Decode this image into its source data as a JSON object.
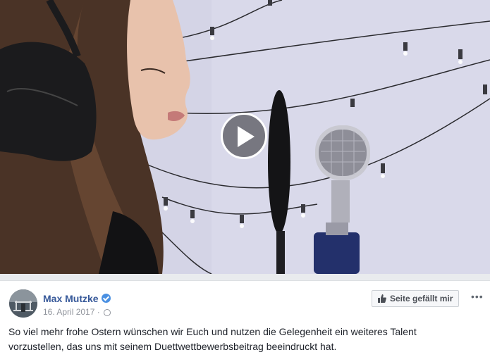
{
  "video": {
    "thumbnail": "woman-singing-into-studio-microphone",
    "play_icon": "play-icon"
  },
  "post": {
    "author": "Max Mutzke",
    "verified_icon": "verified-badge-icon",
    "date": "16. April 2017",
    "separator": "·",
    "privacy_icon": "globe-icon",
    "like_page_label": "Seite gefällt mir",
    "like_icon": "thumbs-up-icon",
    "more_label": "•••",
    "text_line1": "So viel mehr frohe Ostern wünschen wir Euch und nutzen die Gelegenheit ein weiteres Talent",
    "text_line2": "vorzustellen, das uns mit seinem Duettwettbewerbsbeitrag beeindruckt hat."
  },
  "colors": {
    "link": "#365899",
    "meta": "#90949c",
    "verified": "#4a90e2"
  }
}
